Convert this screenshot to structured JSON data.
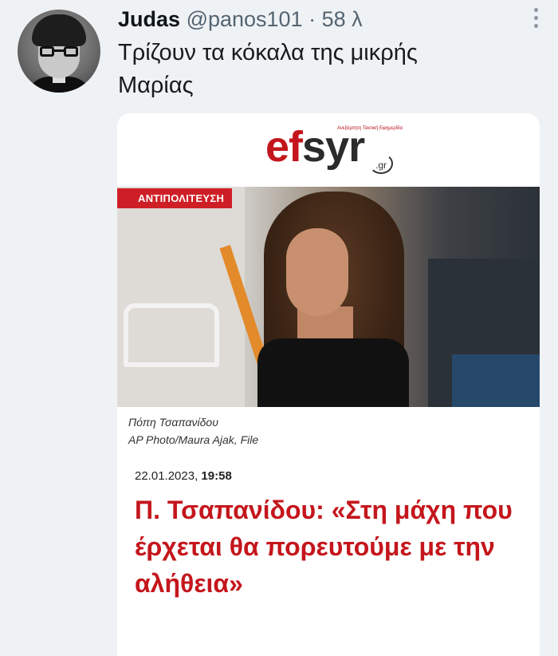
{
  "tweet": {
    "author_name": "Judas",
    "handle": "@panos101",
    "separator": "·",
    "time": "58 λ",
    "text": "Τρίζουν τα κόκαλα της μικρής Μαρίας"
  },
  "article_card": {
    "site_logo": "efsyr",
    "site_logo_suffix": ".gr",
    "site_tagline": "Ανεξάρτητη Τακτική Εφημερίδα",
    "category_badge": "ΑΝΤΙΠΟΛΙΤΕΥΣΗ",
    "photo_caption_name": "Πόπη Τσαπανίδου",
    "photo_credit": "AP Photo/Maura Ajak, File",
    "date": "22.01.2023,",
    "time": "19:58",
    "headline": "Π. Τσαπανίδου: «Στη μάχη που έρχεται θα πορευτούμε με την αλήθεια»"
  },
  "colors": {
    "background": "#eff2f5",
    "brand_red": "#c4161c",
    "muted_text": "#536471"
  }
}
